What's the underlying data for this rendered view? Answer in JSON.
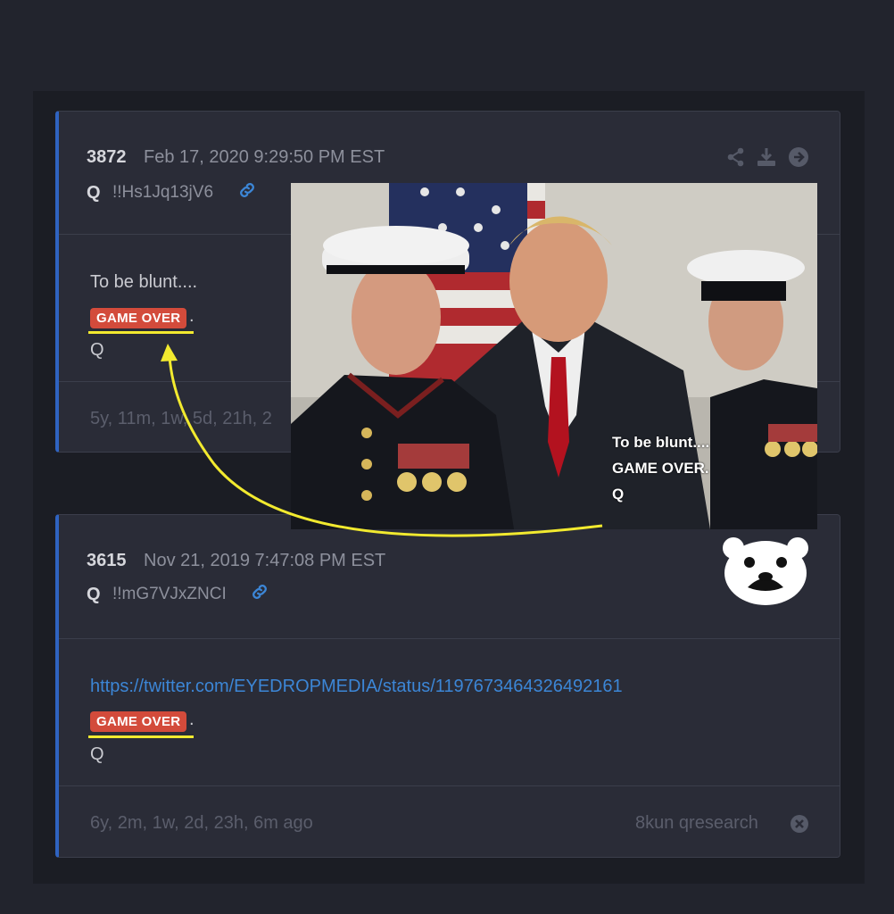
{
  "posts": [
    {
      "number": "3872",
      "date": "Feb 17, 2020 9:29:50 PM EST",
      "author": "Q",
      "tripcode": "!!Hs1Jq13jV6",
      "body_line1": "To be blunt....",
      "badge": "GAME OVER",
      "punct": ".",
      "sign": "Q",
      "age": "5y, 11m, 1w, 5d, 21h, 2"
    },
    {
      "number": "3615",
      "date": "Nov 21, 2019 7:47:08 PM EST",
      "author": "Q",
      "tripcode": "!!mG7VJxZNCI",
      "url": "https://twitter.com/EYEDROPMEDIA/status/1197673464326492161",
      "badge": "GAME OVER",
      "punct": ".",
      "sign": "Q",
      "age": "6y, 2m, 1w, 2d, 23h, 6m ago",
      "source": "8kun qresearch"
    }
  ],
  "overlay_image": {
    "line1": "To be blunt....",
    "line2": "GAME OVER.",
    "line3": "Q"
  },
  "colors": {
    "accent": "#2f63c1",
    "badge": "#d34b3b",
    "highlight": "#f2ea2f",
    "link": "#3c86d6"
  },
  "icons": [
    "share-icon",
    "download-icon",
    "arrow-right-circle-icon",
    "link-icon",
    "close-circle-icon",
    "bear-logo-icon"
  ]
}
